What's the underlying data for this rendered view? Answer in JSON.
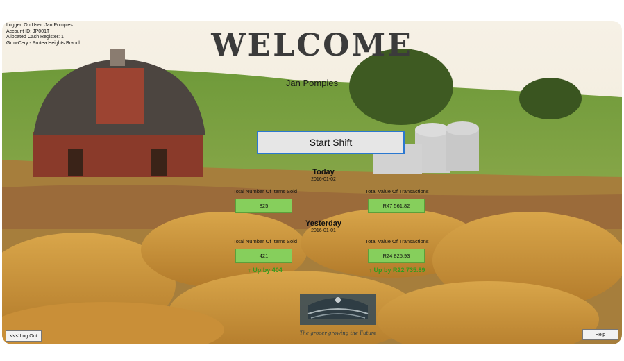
{
  "user_info": {
    "logged_on": "Logged On User: Jan Pompies",
    "account_id": "Account ID: JP001T",
    "register": "Allocated Cash Register: 1",
    "branch": "GrowCery - Protea Heights Branch"
  },
  "welcome_title": "WELCOME",
  "user_name": "Jan Pompies",
  "start_shift_label": "Start Shift",
  "today": {
    "title": "Today",
    "date": "2016-01-02",
    "items_label": "Total Number Of Items Sold",
    "items_value": "825",
    "value_label": "Total Value Of Transactions",
    "value_value": "R47 561.82"
  },
  "yesterday": {
    "title": "Yesterday",
    "date": "2016-01-01",
    "items_label": "Total Number Of Items Sold",
    "items_value": "421",
    "value_label": "Total Value Of Transactions",
    "value_value": "R24 825.93"
  },
  "deltas": {
    "items": "↑ Up by 404",
    "value": "↑ Up by R22 735.89"
  },
  "logo_tagline": "The grocer growing the Future",
  "logout_label": "<<< Log Out",
  "help_label": "Help",
  "colors": {
    "accent": "#2b78d0",
    "value_box": "#86cf5c",
    "delta_text": "#2f9e1e"
  }
}
